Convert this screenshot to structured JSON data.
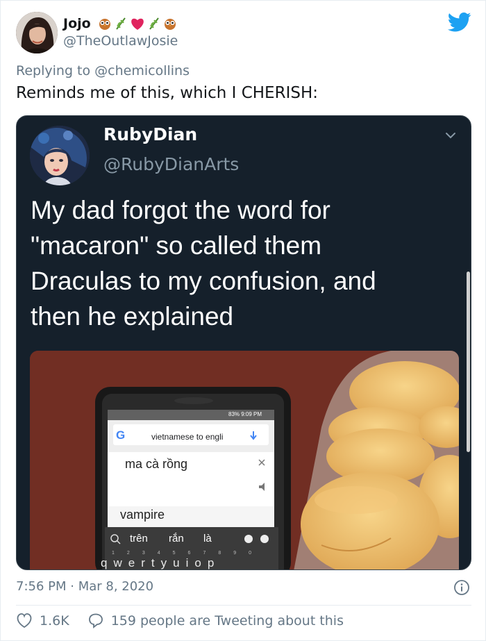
{
  "author": {
    "name": "Jojo",
    "handle": "@TheOutlawJosie"
  },
  "replying": {
    "prefix": "Replying to",
    "mention": "@chemicollins"
  },
  "tweet_text": "Reminds me of this, which I CHERISH:",
  "quoted": {
    "name": "RubyDian",
    "handle": "@RubyDianArts",
    "lines": [
      "My dad forgot the word for",
      "\"macaron\" so called them",
      "Draculas to my confusion, and",
      "then he explained"
    ],
    "photo": {
      "status_bar": "83%  9:09 PM",
      "search_query": "vietnamese to engli",
      "input_text": "ma cà rồng",
      "translation": "vampire",
      "suggestions": [
        "trên",
        "rắn",
        "là"
      ],
      "keyboard_row": [
        "q",
        "w",
        "e",
        "r",
        "t",
        "y",
        "u",
        "i",
        "o",
        "p"
      ],
      "number_row": [
        "1",
        "2",
        "3",
        "4",
        "5",
        "6",
        "7",
        "8",
        "9",
        "0"
      ]
    }
  },
  "timestamp": "7:56 PM · Mar 8, 2020",
  "likes": "1.6K",
  "retweet_text": "159 people are Tweeting about this",
  "colors": {
    "brand": "#1da1f2",
    "heart": "#e0245e",
    "quote_bg": "#15202b"
  },
  "icons": [
    "twitter-bird-icon",
    "chevron-down-icon",
    "info-icon",
    "heart-icon",
    "comment-icon"
  ]
}
